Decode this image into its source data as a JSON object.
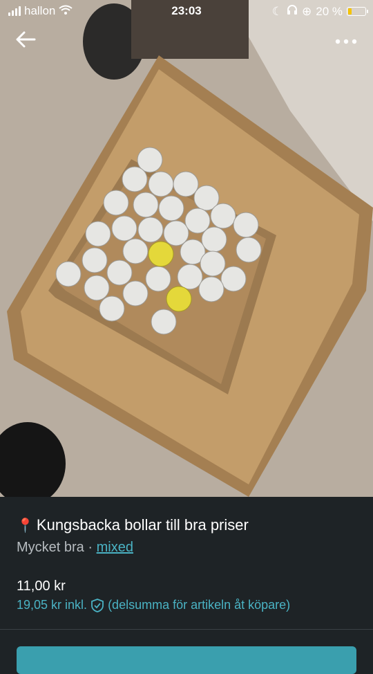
{
  "status": {
    "carrier": "hallon",
    "time": "23:03",
    "battery": "20 %",
    "battery_level": 0.2
  },
  "nav": {
    "back_icon": "arrow-left-icon",
    "more_icon": "more-horizontal-icon"
  },
  "listing": {
    "title": "Kungsbacka bollar till bra priser",
    "condition": "Mycket bra",
    "separator": "·",
    "brand": "mixed",
    "price": "11,00 kr",
    "price_incl": "19,05 kr inkl.",
    "price_note": "(delsumma för artikeln åt köpare)"
  },
  "colors": {
    "accent": "#4ab3c4",
    "button": "#3a9fae",
    "background": "#1e2326"
  }
}
